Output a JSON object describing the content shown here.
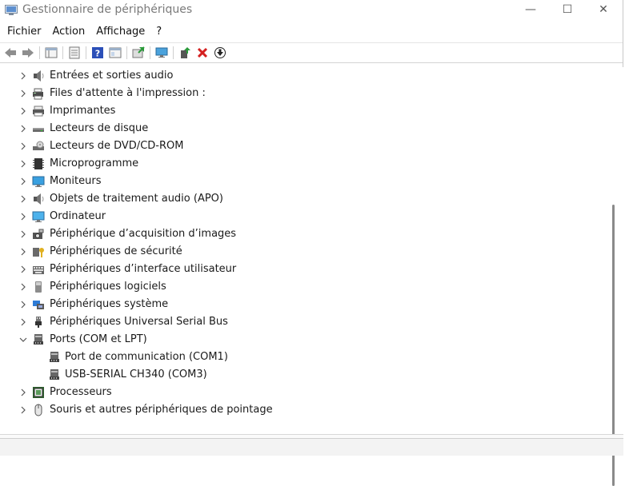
{
  "window": {
    "title": "Gestionnaire de périphériques"
  },
  "caption": {
    "minimize": "—",
    "maximize": "☐",
    "close": "✕"
  },
  "menu": [
    {
      "label": "Fichier",
      "name": "menu-fichier"
    },
    {
      "label": "Action",
      "name": "menu-action"
    },
    {
      "label": "Affichage",
      "name": "menu-affichage"
    },
    {
      "label": "?",
      "name": "menu-help"
    }
  ],
  "toolbar": [
    {
      "icon": "back-arrow-icon"
    },
    {
      "icon": "forward-arrow-icon"
    },
    {
      "sep": true
    },
    {
      "icon": "show-hide-tree-icon"
    },
    {
      "sep": true
    },
    {
      "icon": "properties-icon"
    },
    {
      "sep": true
    },
    {
      "icon": "help-icon"
    },
    {
      "icon": "show-details-icon"
    },
    {
      "sep": true
    },
    {
      "icon": "update-driver-icon"
    },
    {
      "sep": true
    },
    {
      "icon": "scan-hardware-icon"
    },
    {
      "sep": true
    },
    {
      "icon": "enable-device-icon"
    },
    {
      "icon": "uninstall-device-icon"
    },
    {
      "icon": "disable-device-icon"
    }
  ],
  "tree": [
    {
      "label": "Entrées et sorties audio",
      "icon": "speaker-icon",
      "expanded": false
    },
    {
      "label": "Files d'attente à l'impression :",
      "icon": "print-queue-icon",
      "expanded": false
    },
    {
      "label": "Imprimantes",
      "icon": "printer-icon",
      "expanded": false
    },
    {
      "label": "Lecteurs de disque",
      "icon": "disk-drive-icon",
      "expanded": false
    },
    {
      "label": "Lecteurs de DVD/CD-ROM",
      "icon": "dvd-drive-icon",
      "expanded": false
    },
    {
      "label": "Microprogramme",
      "icon": "firmware-icon",
      "expanded": false
    },
    {
      "label": "Moniteurs",
      "icon": "monitor-icon",
      "expanded": false
    },
    {
      "label": "Objets de traitement audio (APO)",
      "icon": "speaker-icon",
      "expanded": false
    },
    {
      "label": "Ordinateur",
      "icon": "computer-icon",
      "expanded": false
    },
    {
      "label": "Périphérique d’acquisition d’images",
      "icon": "camera-icon",
      "expanded": false
    },
    {
      "label": "Périphériques de sécurité",
      "icon": "security-key-icon",
      "expanded": false
    },
    {
      "label": "Périphériques d’interface utilisateur",
      "icon": "hid-keyboard-icon",
      "expanded": false
    },
    {
      "label": "Périphériques logiciels",
      "icon": "software-device-icon",
      "expanded": false
    },
    {
      "label": "Périphériques système",
      "icon": "system-device-icon",
      "expanded": false
    },
    {
      "label": "Périphériques Universal Serial Bus",
      "icon": "usb-icon",
      "expanded": false
    },
    {
      "label": "Ports (COM et LPT)",
      "icon": "port-icon",
      "expanded": true,
      "children": [
        {
          "label": "Port de communication (COM1)",
          "icon": "port-icon"
        },
        {
          "label": "USB-SERIAL CH340 (COM3)",
          "icon": "port-icon"
        }
      ]
    },
    {
      "label": "Processeurs",
      "icon": "processor-icon",
      "expanded": false
    },
    {
      "label": "Souris et autres périphériques de pointage",
      "icon": "mouse-icon",
      "expanded": false
    }
  ],
  "colors": {
    "accent": "#2b6fd6",
    "error": "#d42020",
    "ok": "#2a9a3a"
  }
}
